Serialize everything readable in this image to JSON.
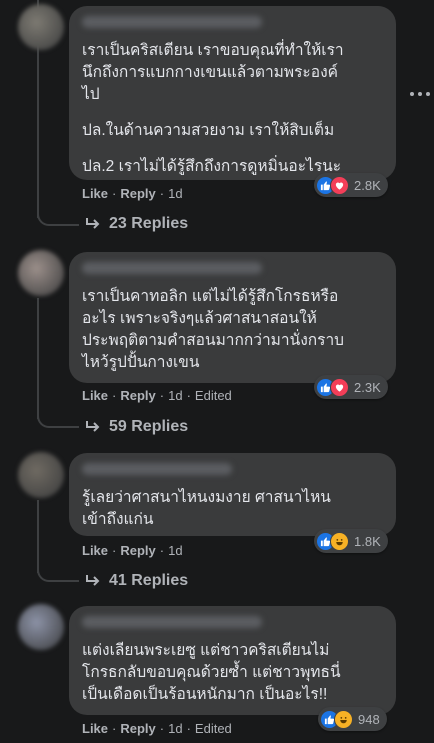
{
  "menu": {
    "more_icon": "more-horizontal-icon"
  },
  "comments": [
    {
      "avatar_color": "#7d7a72",
      "paragraphs": [
        "เราเป็นคริสเตียน เราขอบคุณที่ทำให้เรา\nนึกถึงการแบกกางเขนแล้วตามพระองค์\nไป",
        "ปล.ในด้านความสวยงาม เราให้สิบเต็ม",
        "ปล.2 เราไม่ได้รู้สึกถึงการดูหมิ่นอะไรนะ"
      ],
      "reaction_icons": [
        "like-icon",
        "heart-icon"
      ],
      "reaction_count": "2.8K",
      "like_label": "Like",
      "reply_label": "Reply",
      "time": "1d",
      "edited": "",
      "replies_label": "23 Replies"
    },
    {
      "avatar_color": "#9b8f8a",
      "paragraphs": [
        "เราเป็นคาทอลิก แต่ไม่ได้รู้สึกโกรธหรือ\nอะไร เพราะจริงๆแล้วศาสนาสอนให้\nประพฤติตามคำสอนมากกว่ามานั่งกราบ\nไหว้รูปปั้นกางเขน"
      ],
      "reaction_icons": [
        "like-icon",
        "heart-icon"
      ],
      "reaction_count": "2.3K",
      "like_label": "Like",
      "reply_label": "Reply",
      "time": "1d",
      "edited": "Edited",
      "replies_label": "59 Replies"
    },
    {
      "avatar_color": "#6f6a62",
      "paragraphs": [
        "รู้เลยว่าศาสนาไหนงมงาย ศาสนาไหน\nเข้าถึงแก่น"
      ],
      "reaction_icons": [
        "like-icon",
        "haha-icon"
      ],
      "reaction_count": "1.8K",
      "like_label": "Like",
      "reply_label": "Reply",
      "time": "1d",
      "edited": "",
      "replies_label": "41 Replies"
    },
    {
      "avatar_color": "#8c92a6",
      "paragraphs": [
        "แต่งเลียนพระเยซู แต่ชาวคริสเตียนไม่\nโกรธกลับขอบคุณด้วยซ้ำ แต่ชาวพุทธนี่\nเป็นเดือดเป็นร้อนหนักมาก เป็นอะไร!!"
      ],
      "reaction_icons": [
        "like-icon",
        "haha-icon"
      ],
      "reaction_count": "948",
      "like_label": "Like",
      "reply_label": "Reply",
      "time": "1d",
      "edited": "Edited",
      "replies_label": ""
    }
  ]
}
